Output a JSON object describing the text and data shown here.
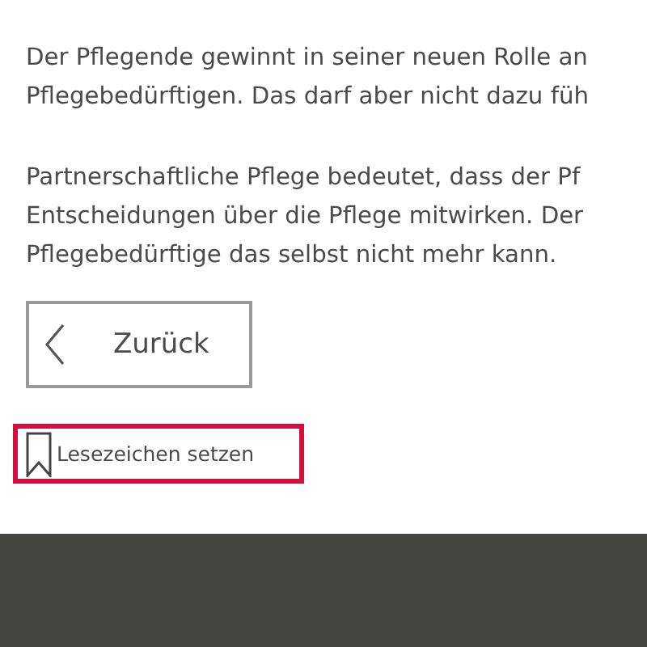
{
  "paragraphs": [
    {
      "lines": [
        "Der Pflegende gewinnt in seiner neuen Rolle an",
        "Pflegebedürftigen. Das darf aber nicht dazu füh"
      ]
    },
    {
      "lines": [
        "Partnerschaftliche Pflege bedeutet, dass der Pf",
        "Entscheidungen über die Pflege mitwirken. Der",
        "Pflegebedürftige das selbst nicht mehr kann."
      ]
    }
  ],
  "back_button": {
    "label": "Zurück"
  },
  "bookmark": {
    "label": "Lesezeichen setzen",
    "focused": true
  }
}
